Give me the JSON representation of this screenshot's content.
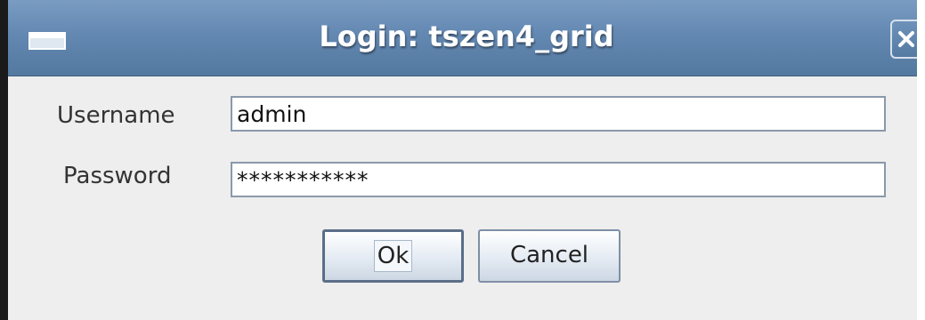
{
  "window": {
    "title": "Login: tszen4_grid",
    "close_icon": "close-x-icon",
    "app_icon": "window-icon"
  },
  "form": {
    "username": {
      "label": "Username",
      "value": "admin"
    },
    "password": {
      "label": "Password",
      "value": "***********"
    }
  },
  "buttons": {
    "ok": "Ok",
    "cancel": "Cancel"
  },
  "colors": {
    "titlebar": "#6388b2",
    "window_bg": "#eeeeee",
    "field_border": "#8a99ab"
  }
}
